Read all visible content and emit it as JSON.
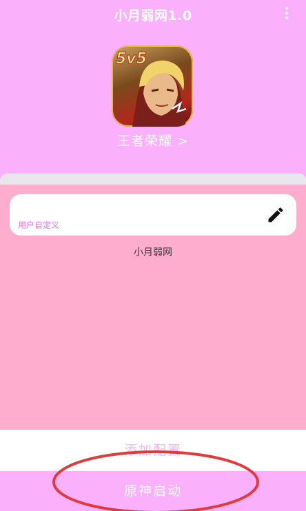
{
  "header": {
    "title": "小月弱网1.0",
    "menu_icon": "more-vert-icon"
  },
  "game": {
    "icon": "honor-of-kings-app-icon",
    "badge": "5v5",
    "name": "王者荣耀 >"
  },
  "panel": {
    "input_label": "用户自定义",
    "edit_icon": "pencil-icon",
    "caption": "小月弱网"
  },
  "buttons": {
    "add_config": "添加配置",
    "launch": "原神启动"
  },
  "colors": {
    "background": "#fbb0fb",
    "panel": "#ffadcf",
    "accent_text": "#ea6ee0",
    "annotation_circle": "#e23a3a"
  }
}
